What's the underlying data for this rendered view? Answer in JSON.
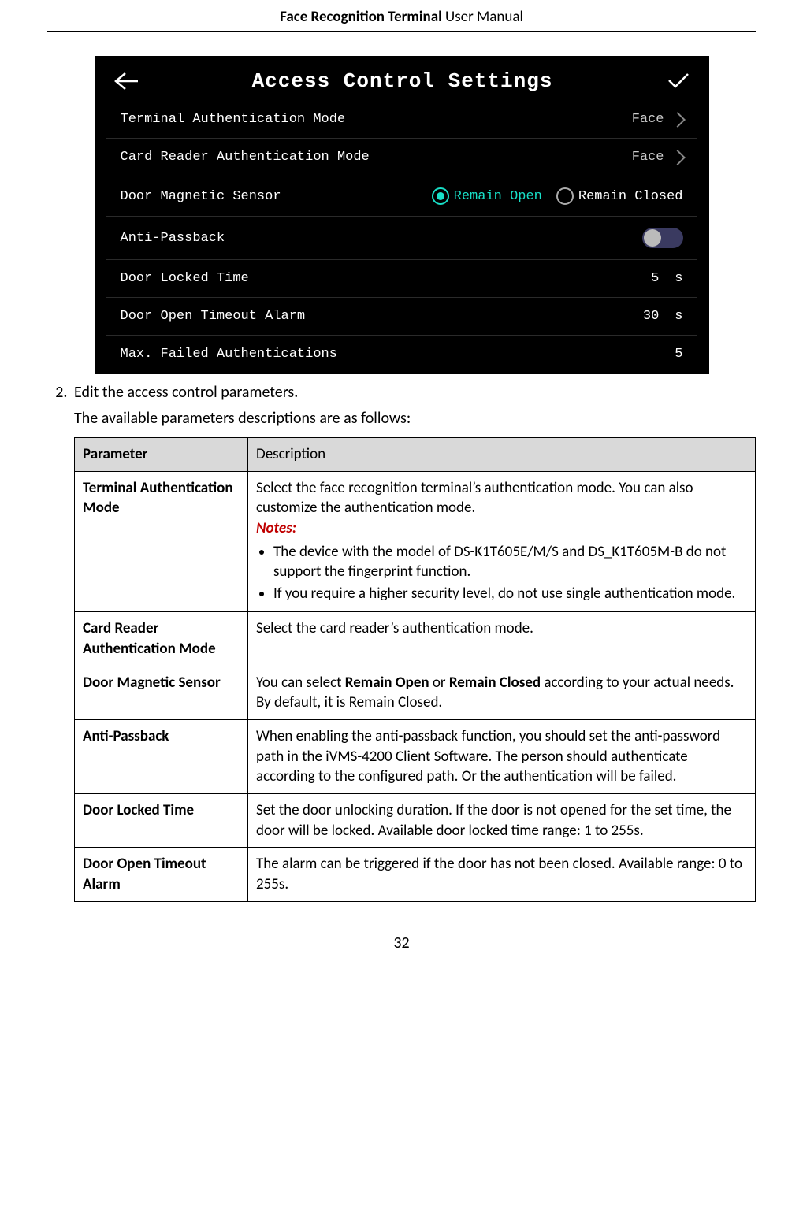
{
  "header": {
    "bold": "Face Recognition Terminal",
    "rest": "  User Manual"
  },
  "screenshot": {
    "title": "Access Control Settings",
    "rows": {
      "terminalAuth": {
        "label": "Terminal Authentication Mode",
        "value": "Face"
      },
      "cardReaderAuth": {
        "label": "Card Reader Authentication Mode",
        "value": "Face"
      },
      "doorMag": {
        "label": "Door Magnetic Sensor",
        "open": "Remain Open",
        "closed": "Remain Closed",
        "selected": "open"
      },
      "antiPassback": {
        "label": "Anti-Passback",
        "on": false
      },
      "doorLocked": {
        "label": "Door Locked Time",
        "value": "5",
        "unit": "s"
      },
      "doorOpenTimeout": {
        "label": "Door Open Timeout Alarm",
        "value": "30",
        "unit": "s"
      },
      "maxFailed": {
        "label": "Max. Failed Authentications",
        "value": "5"
      }
    }
  },
  "step2": {
    "number": "2.",
    "line1": "Edit the access control parameters.",
    "line2": "The available parameters descriptions are as follows:"
  },
  "table": {
    "headers": {
      "param": "Parameter",
      "desc": "Description"
    },
    "rows": {
      "tam": {
        "name": "Terminal Authentication Mode",
        "intro": "Select the face recognition terminal’s authentication mode. You can also customize the authentication mode.",
        "notesLabel": "Notes:",
        "b1": "The device with the model of DS-K1T605E/M/S and DS_K1T605M-B do not support the fingerprint function.",
        "b2": "If you require a higher security level, do not use single authentication mode."
      },
      "cram": {
        "name": "Card Reader Authentication Mode",
        "desc": "Select the card reader’s authentication mode."
      },
      "dms": {
        "name": "Door Magnetic Sensor",
        "pre": "You can select ",
        "b1": "Remain Open",
        "mid": " or ",
        "b2": "Remain Closed",
        "post": " according to your actual needs. By default, it is Remain Closed."
      },
      "ap": {
        "name": "Anti-Passback",
        "desc": "When enabling the anti-passback function, you should set the anti-password path in the iVMS-4200 Client Software. The person should authenticate according to the configured path. Or the authentication will be failed."
      },
      "dlt": {
        "name": "Door Locked Time",
        "desc": "Set the door unlocking duration. If the door is not opened for the set time, the door will be locked. Available door locked time range: 1 to 255s."
      },
      "dota": {
        "name": "Door Open Timeout Alarm",
        "desc": "The alarm can be triggered if the door has not been closed. Available range: 0 to 255s."
      }
    }
  },
  "pageNumber": "32"
}
